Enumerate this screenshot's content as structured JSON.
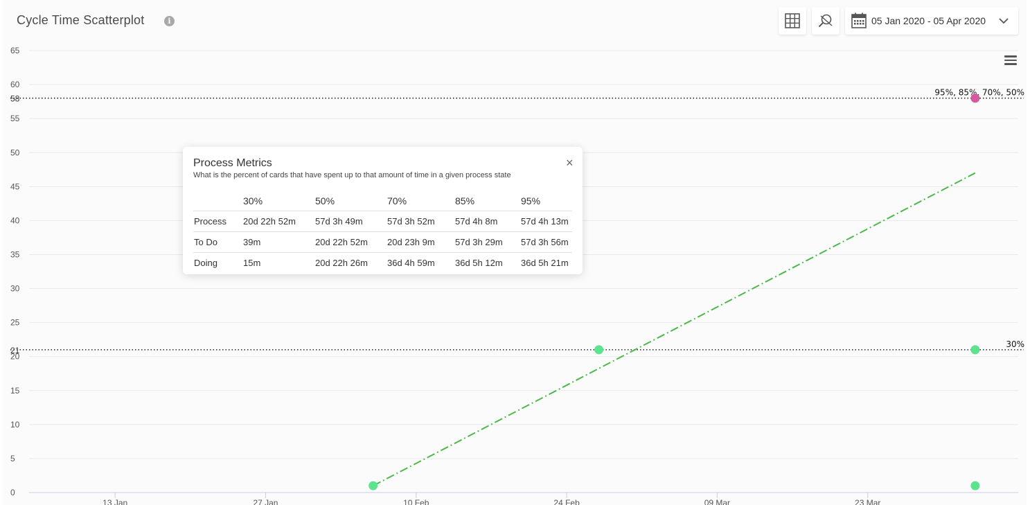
{
  "header": {
    "title": "Cycle Time Scatterplot",
    "info_icon": "info-icon",
    "grid_icon": "grid-icon",
    "zoom_icon": "zoom-reset-icon",
    "calendar_icon": "calendar-icon",
    "date_range": "05 Jan 2020 - 05 Apr 2020",
    "dropdown_icon": "chevron-down-icon",
    "menu_icon": "hamburger-menu-icon"
  },
  "chart_data": {
    "type": "scatter",
    "title": "Cycle Time Scatterplot",
    "xlabel": "",
    "ylabel": "",
    "ylim": [
      0,
      65
    ],
    "y_ticks": [
      0,
      5,
      10,
      15,
      20,
      25,
      30,
      35,
      40,
      45,
      50,
      55,
      60,
      65
    ],
    "x_ticks": [
      "13 Jan",
      "27 Jan",
      "10 Feb",
      "24 Feb",
      "09 Mar",
      "23 Mar"
    ],
    "x_ticks_dates": [
      "2020-01-13",
      "2020-01-27",
      "2020-02-10",
      "2020-02-24",
      "2020-03-09",
      "2020-03-23"
    ],
    "x_range": [
      "2020-01-05",
      "2020-04-06"
    ],
    "grid": true,
    "points": [
      {
        "x": "2020-02-06",
        "y": 1,
        "color": "#5de38d"
      },
      {
        "x": "2020-02-27",
        "y": 21,
        "color": "#5de38d"
      },
      {
        "x": "2020-04-02",
        "y": 21,
        "color": "#5de38d"
      },
      {
        "x": "2020-04-02",
        "y": 58,
        "color": "#d35aa0"
      },
      {
        "x": "2020-04-02",
        "y": 1,
        "color": "#5de38d"
      }
    ],
    "trend_line": {
      "from": {
        "x": "2020-02-06",
        "y": 1
      },
      "to": {
        "x": "2020-04-02",
        "y": 47
      },
      "color": "#4db84a",
      "style": "dash-dot"
    },
    "percentile_lines": [
      {
        "y": 58,
        "y_label": "58",
        "label": "95%, 85%, 70%, 50%"
      },
      {
        "y": 21,
        "y_label": "21",
        "label": "30%"
      }
    ]
  },
  "process_metrics": {
    "title": "Process Metrics",
    "subtitle": "What is the percent of cards that have spent up to that amount of time in a given process state",
    "close_label": "×",
    "columns": [
      "",
      "30%",
      "50%",
      "70%",
      "85%",
      "95%"
    ],
    "rows": [
      [
        "Process",
        "20d 22h 52m",
        "57d 3h 49m",
        "57d 3h 52m",
        "57d 4h 8m",
        "57d 4h 13m"
      ],
      [
        "To Do",
        "39m",
        "20d 22h 52m",
        "20d 23h 9m",
        "57d 3h 29m",
        "57d 3h 56m"
      ],
      [
        "Doing",
        "15m",
        "20d 22h 26m",
        "36d 4h 59m",
        "36d 5h 12m",
        "36d 5h 21m"
      ]
    ]
  }
}
